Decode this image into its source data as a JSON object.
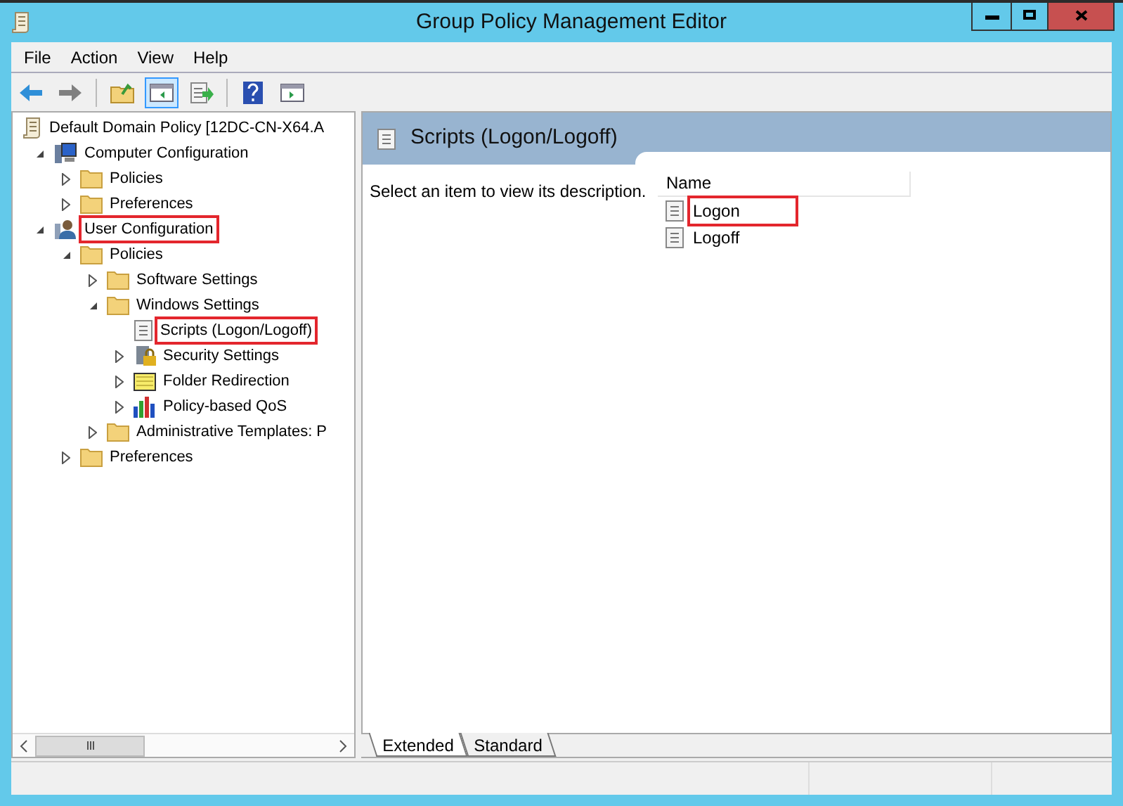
{
  "window": {
    "title": "Group Policy Management Editor"
  },
  "menu": [
    "File",
    "Action",
    "View",
    "Help"
  ],
  "toolbar": [
    {
      "kind": "back",
      "selected": false
    },
    {
      "kind": "forward",
      "selected": false
    },
    {
      "kind": "up",
      "selected": false
    },
    {
      "kind": "tree",
      "selected": true
    },
    {
      "kind": "export",
      "selected": false
    },
    {
      "kind": "help",
      "selected": false
    },
    {
      "kind": "pane",
      "selected": false
    }
  ],
  "tree": [
    {
      "label": "Default Domain Policy [12DC-CN-X64.A",
      "kind": "scroll",
      "highlighted": false,
      "children": [
        {
          "label": "Computer Configuration",
          "kind": "computer",
          "toggle": true,
          "expanded": true,
          "highlighted": false,
          "children": [
            {
              "label": "Policies",
              "kind": "folder",
              "toggle": true,
              "expanded": false,
              "highlighted": false
            },
            {
              "label": "Preferences",
              "kind": "folder",
              "toggle": true,
              "expanded": false,
              "highlighted": false
            }
          ]
        },
        {
          "label": "User Configuration",
          "kind": "user",
          "toggle": true,
          "expanded": true,
          "highlighted": true,
          "children": [
            {
              "label": "Policies",
              "kind": "folder",
              "toggle": true,
              "expanded": true,
              "highlighted": false,
              "children": [
                {
                  "label": "Software Settings",
                  "kind": "folder",
                  "toggle": true,
                  "expanded": false,
                  "highlighted": false
                },
                {
                  "label": "Windows Settings",
                  "kind": "folder",
                  "toggle": true,
                  "expanded": true,
                  "highlighted": false,
                  "children": [
                    {
                      "label": "Scripts (Logon/Logoff)",
                      "kind": "script",
                      "toggle": false,
                      "expanded": false,
                      "highlighted": true
                    },
                    {
                      "label": "Security Settings",
                      "kind": "lock",
                      "toggle": true,
                      "expanded": false,
                      "highlighted": false
                    },
                    {
                      "label": "Folder Redirection",
                      "kind": "redirect",
                      "toggle": true,
                      "expanded": false,
                      "highlighted": false
                    },
                    {
                      "label": "Policy-based QoS",
                      "kind": "chart",
                      "toggle": true,
                      "expanded": false,
                      "highlighted": false
                    }
                  ]
                },
                {
                  "label": "Administrative Templates: P",
                  "kind": "folder",
                  "toggle": true,
                  "expanded": false,
                  "highlighted": false
                }
              ]
            },
            {
              "label": "Preferences",
              "kind": "folder",
              "toggle": true,
              "expanded": false,
              "highlighted": false
            }
          ]
        }
      ]
    }
  ],
  "details": {
    "title": "Scripts (Logon/Logoff)",
    "description": "Select an item to view its description.",
    "column": "Name",
    "items": [
      {
        "label": "Logon",
        "highlighted": true
      },
      {
        "label": "Logoff",
        "highlighted": false
      }
    ]
  },
  "view_tabs": [
    {
      "label": "Extended",
      "selected": true
    },
    {
      "label": "Standard",
      "selected": false
    }
  ]
}
